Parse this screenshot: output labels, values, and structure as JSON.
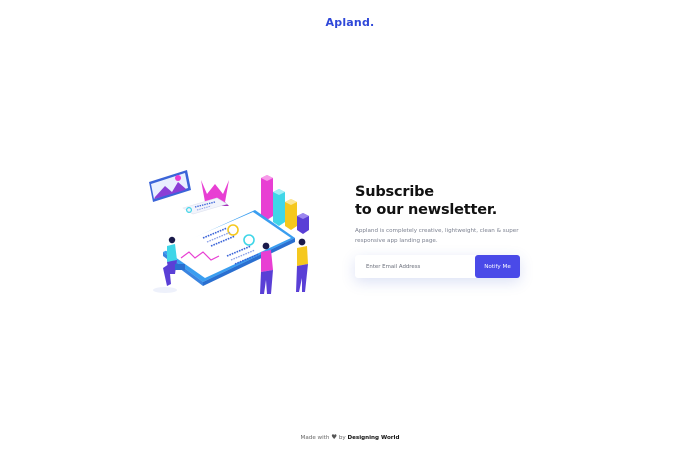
{
  "brand": {
    "name": "Apland",
    "dot": "."
  },
  "hero": {
    "headline_line1": "Subscribe",
    "headline_line2": "to our newsletter.",
    "description": "Appland is completely creative, lightweight, clean & super responsive app landing page."
  },
  "form": {
    "email_placeholder": "Enter Email Address",
    "email_value": "",
    "submit_label": "Notify Me"
  },
  "footer": {
    "made_with": "Made with",
    "heart_icon": "heart-icon",
    "by": "by",
    "credit": "Designing World"
  },
  "colors": {
    "brand_blue": "#2f48d9",
    "button": "#4a4ae8",
    "text_dark": "#111111",
    "text_muted": "#7a7f8e",
    "accent_pink": "#e83fd3",
    "accent_cyan": "#3fd6e8",
    "accent_yellow": "#f5c81e",
    "accent_purple": "#5a3fd6"
  }
}
